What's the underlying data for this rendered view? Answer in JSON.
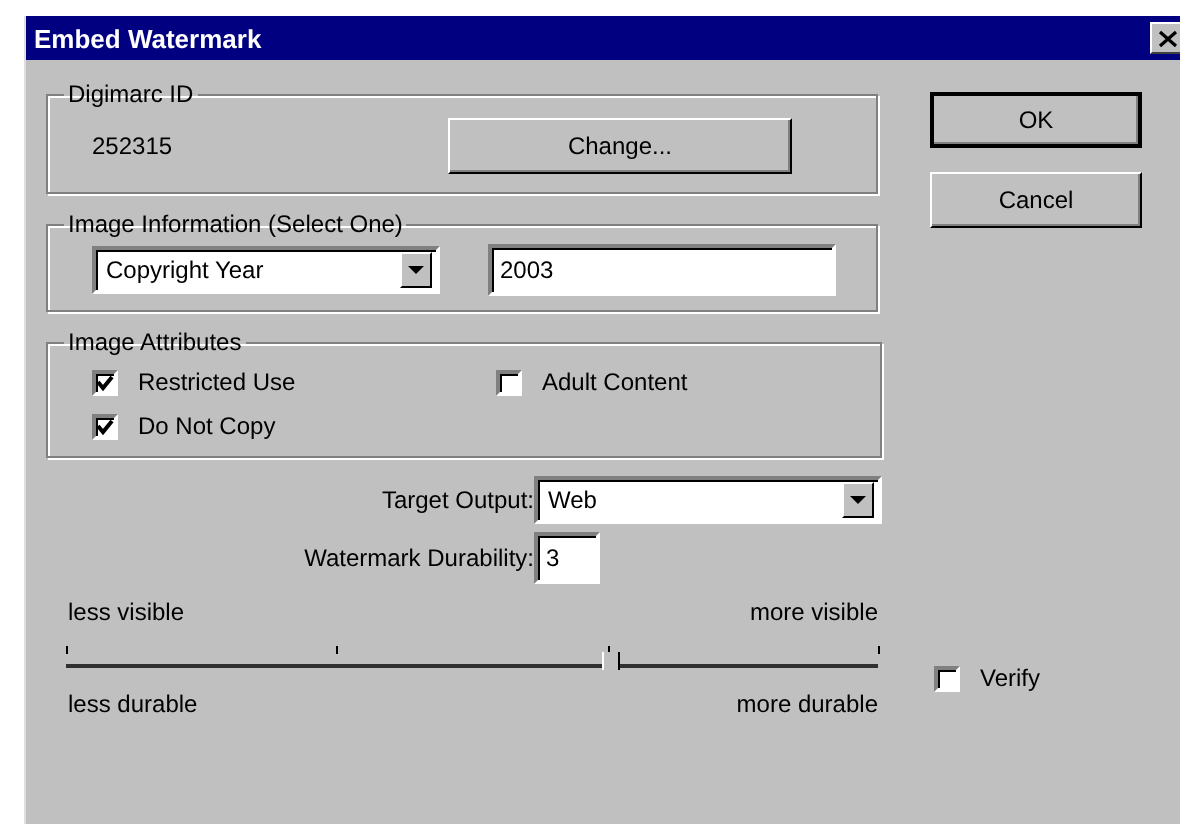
{
  "window": {
    "title": "Embed Watermark"
  },
  "digimarc": {
    "legend": "Digimarc ID",
    "id": "252315",
    "button": "Change..."
  },
  "image_information": {
    "legend": "Image Information (Select One)",
    "type": "Copyright Year",
    "value": "2003"
  },
  "image_attributes": {
    "legend": "Image Attributes",
    "options": [
      {
        "label": "Restricted Use",
        "checked": true
      },
      {
        "label": "Adult Content",
        "checked": false
      },
      {
        "label": "Do Not Copy",
        "checked": true
      }
    ]
  },
  "target_output": {
    "label": "Target Output:",
    "value": "Web"
  },
  "durability": {
    "label": "Watermark Durability:",
    "value": "3",
    "top_left": "less visible",
    "top_right": "more visible",
    "bottom_left": "less durable",
    "bottom_right": "more durable",
    "level": 0.667
  },
  "verify": {
    "label": "Verify",
    "checked": false
  },
  "buttons": [
    "OK",
    "Cancel"
  ]
}
